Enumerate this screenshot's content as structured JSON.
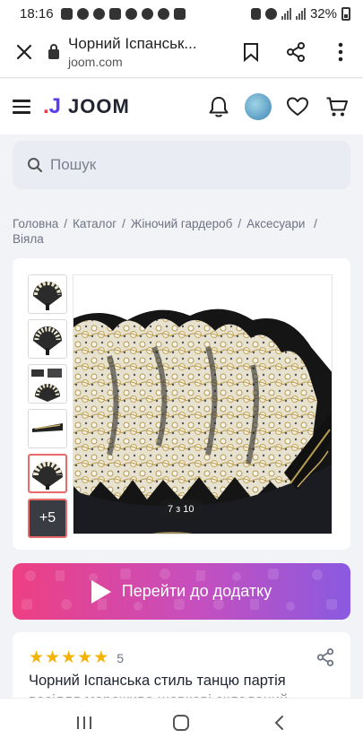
{
  "status_bar": {
    "time": "18:16",
    "battery": "32%"
  },
  "browser": {
    "page_title": "Чорний Іспанськ...",
    "domain": "joom.com"
  },
  "site": {
    "logo_text": "JOOM"
  },
  "search": {
    "placeholder": "Пошук"
  },
  "breadcrumbs": [
    {
      "label": "Головна"
    },
    {
      "label": "Каталог"
    },
    {
      "label": "Жіночий гардероб"
    },
    {
      "label": "Аксесуари"
    },
    {
      "label": "Віяла"
    }
  ],
  "breadcrumb_separator": "/",
  "gallery": {
    "more_label": "+5",
    "counter": "7 з 10"
  },
  "cta": {
    "label": "Перейти до додатку"
  },
  "product": {
    "rating_value": "5",
    "stars": 5,
    "title": "Чорний Іспанська стиль танцю партія весілля мереживо шовкові складаний"
  },
  "colors": {
    "accent_red": "#e8364b",
    "accent_purple": "#5a3df0",
    "star": "#f3b300",
    "cta_gradient_start": "#ee3f83",
    "cta_gradient_end": "#8a5ae0"
  }
}
